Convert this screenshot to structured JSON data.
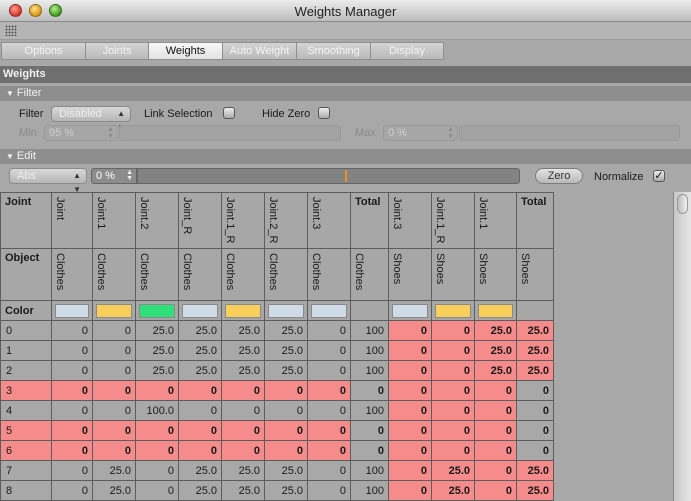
{
  "window": {
    "title": "Weights Manager"
  },
  "tabs": [
    "Options",
    "Joints",
    "Weights",
    "Auto Weight",
    "Smoothing",
    "Display"
  ],
  "active_tab": "Weights",
  "sections": {
    "weights": "Weights",
    "filter": "Filter",
    "edit": "Edit"
  },
  "filter": {
    "filter_label": "Filter",
    "filter_value": "Disabled",
    "link_selection_label": "Link Selection",
    "hide_zero_label": "Hide Zero",
    "min_label": "Min",
    "min_value": "95 %",
    "max_label": "Max",
    "max_value": "0 %"
  },
  "edit": {
    "mode_value": "Abs",
    "weight_value": "0 %",
    "zero_button": "Zero",
    "normalize_label": "Normalize",
    "normalize_checked": "✓"
  },
  "table": {
    "row_labels": {
      "joint": "Joint",
      "object": "Object",
      "color": "Color"
    },
    "joints": [
      "Joint",
      "Joint.1",
      "Joint.2",
      "Joint_R",
      "Joint.1_R",
      "Joint.2_R",
      "Joint.3",
      "Total",
      "Joint.3",
      "Joint.1_R",
      "Joint.1",
      "Total"
    ],
    "objects": [
      "Clothes",
      "Clothes",
      "Clothes",
      "Clothes",
      "Clothes",
      "Clothes",
      "Clothes",
      "Clothes",
      "Shoes",
      "Shoes",
      "Shoes",
      "Shoes"
    ],
    "colors": [
      "#cfdbe6",
      "#f7cf5a",
      "#2fe07a",
      "#cfdbe6",
      "#f7cf5a",
      "#cfdbe6",
      "#cfdbe6",
      "",
      "#cfdbe6",
      "#f7cf5a",
      "#f7cf5a",
      ""
    ],
    "rows": [
      {
        "index": "0",
        "values": [
          "0",
          "0",
          "25.0",
          "25.0",
          "25.0",
          "25.0",
          "0",
          "100",
          "0",
          "0",
          "25.0",
          "25.0"
        ]
      },
      {
        "index": "1",
        "values": [
          "0",
          "0",
          "25.0",
          "25.0",
          "25.0",
          "25.0",
          "0",
          "100",
          "0",
          "0",
          "25.0",
          "25.0"
        ]
      },
      {
        "index": "2",
        "values": [
          "0",
          "0",
          "25.0",
          "25.0",
          "25.0",
          "25.0",
          "0",
          "100",
          "0",
          "0",
          "25.0",
          "25.0"
        ]
      },
      {
        "index": "3",
        "values": [
          "0",
          "0",
          "0",
          "0",
          "0",
          "0",
          "0",
          "0",
          "0",
          "0",
          "0",
          "0"
        ]
      },
      {
        "index": "4",
        "values": [
          "0",
          "0",
          "100.0",
          "0",
          "0",
          "0",
          "0",
          "100",
          "0",
          "0",
          "0",
          "0"
        ]
      },
      {
        "index": "5",
        "values": [
          "0",
          "0",
          "0",
          "0",
          "0",
          "0",
          "0",
          "0",
          "0",
          "0",
          "0",
          "0"
        ]
      },
      {
        "index": "6",
        "values": [
          "0",
          "0",
          "0",
          "0",
          "0",
          "0",
          "0",
          "0",
          "0",
          "0",
          "0",
          "0"
        ]
      },
      {
        "index": "7",
        "values": [
          "0",
          "25.0",
          "0",
          "25.0",
          "25.0",
          "25.0",
          "0",
          "100",
          "0",
          "25.0",
          "0",
          "25.0"
        ]
      },
      {
        "index": "8",
        "values": [
          "0",
          "25.0",
          "0",
          "25.0",
          "25.0",
          "25.0",
          "0",
          "100",
          "0",
          "25.0",
          "0",
          "25.0"
        ]
      }
    ]
  }
}
